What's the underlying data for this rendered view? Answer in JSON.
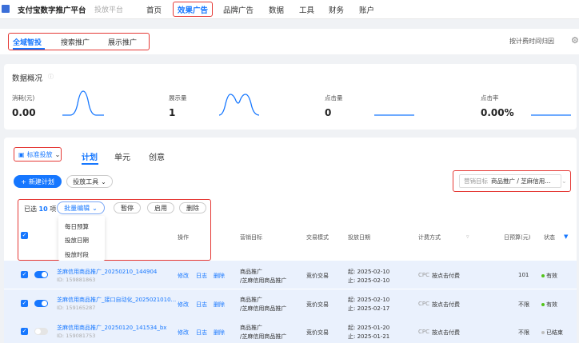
{
  "topnav": {
    "brand": "支付宝数字推广平台",
    "subbrand": "投放平台",
    "items": [
      "首页",
      "效果广告",
      "品牌广告",
      "数据",
      "工具",
      "财务",
      "账户"
    ],
    "active_index": 1
  },
  "subtabs": {
    "items": [
      "全域智投",
      "搜索推广",
      "展示推广"
    ],
    "active_index": 0,
    "billing": "按计费时间归因"
  },
  "overview": {
    "title": "数据概况",
    "metrics": [
      {
        "label": "消耗(元)",
        "value": "0.00"
      },
      {
        "label": "展示量",
        "value": "1"
      },
      {
        "label": "点击量",
        "value": "0"
      },
      {
        "label": "点击率",
        "value": "0.00%"
      }
    ]
  },
  "panel": {
    "std_label": "标准投放",
    "tabs": [
      "计划",
      "单元",
      "创意"
    ],
    "active_tab": 0,
    "new_plan": "新建计划",
    "tools": "投放工具",
    "goal_label": "营销目标",
    "goal_value": "商品推广 / 芝麻信用...",
    "selected_prefix": "已选",
    "selected_count": "10",
    "selected_suffix": "项",
    "batch_edit": "批量编辑",
    "actions": [
      "暂停",
      "启用",
      "删除"
    ],
    "batch_menu": [
      "每日预算",
      "投放日期",
      "投放时段"
    ]
  },
  "table": {
    "headers": [
      "操作",
      "营销目标",
      "交易模式",
      "投放日期",
      "计费方式",
      "日预算(元)",
      "状态"
    ],
    "op_links": [
      "修改",
      "日志",
      "删除"
    ],
    "rows": [
      {
        "name": "芝麻信用商品推广_20250210_144904",
        "id": "ID: 159881863",
        "goal1": "商品推广",
        "goal2": "/芝麻信用商品推广",
        "mode": "竞价交易",
        "start": "起: 2025-02-10",
        "end": "止: 2025-02-10",
        "cpc": "CPC",
        "bill": "按点击付费",
        "budget": "101",
        "status": "有效",
        "status_color": "#52c41a",
        "on": true
      },
      {
        "name": "芝麻信用商品推广_接口自动化_2025021010...",
        "id": "ID: 159165287",
        "goal1": "商品推广",
        "goal2": "/芝麻信用商品推广",
        "mode": "竞价交易",
        "start": "起: 2025-02-10",
        "end": "止: 2025-02-17",
        "cpc": "CPC",
        "bill": "按点击付费",
        "budget": "不限",
        "status": "有效",
        "status_color": "#52c41a",
        "on": true
      },
      {
        "name": "芝麻信用商品推广_20250120_141534_bx",
        "id": "ID: 159081753",
        "goal1": "商品推广",
        "goal2": "/芝麻信用商品推广",
        "mode": "竞价交易",
        "start": "起: 2025-01-20",
        "end": "止: 2025-01-21",
        "cpc": "CPC",
        "bill": "按点击付费",
        "budget": "不限",
        "status": "已结束",
        "status_color": "#bfbfbf",
        "on": false
      }
    ]
  },
  "colors": {
    "accent": "#1677ff",
    "highlight": "#e53935"
  }
}
